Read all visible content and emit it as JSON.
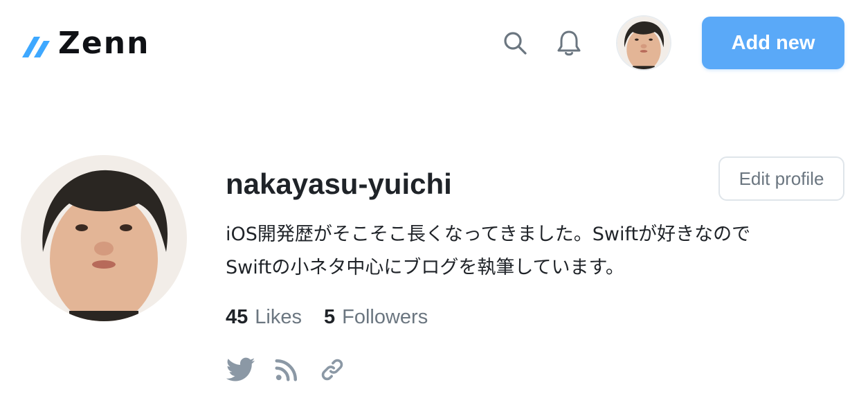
{
  "header": {
    "logo_text": "Zenn",
    "add_button_label": "Add new",
    "icons": {
      "search": "search-icon",
      "notifications": "bell-icon",
      "avatar": "user-avatar"
    },
    "accent_color": "#5aa9f8"
  },
  "profile": {
    "username": "nakayasu-yuichi",
    "edit_button_label": "Edit profile",
    "bio": "iOS開発歴がそこそこ長くなってきました。Swiftが好きなので\nSwiftの小ネタ中心にブログを執筆しています。",
    "stats": [
      {
        "count": "45",
        "label": "Likes"
      },
      {
        "count": "5",
        "label": "Followers"
      }
    ],
    "social_icons": [
      "twitter-icon",
      "rss-icon",
      "link-icon"
    ]
  }
}
